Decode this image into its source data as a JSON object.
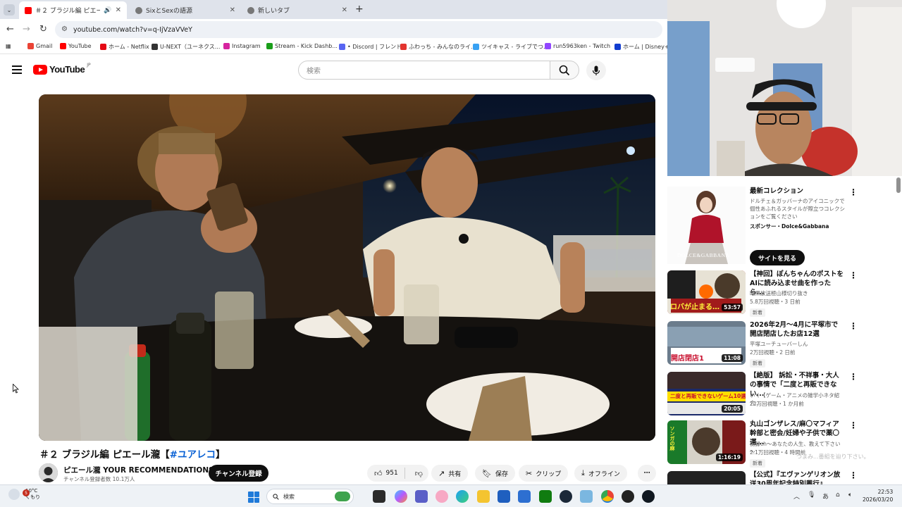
{
  "browser": {
    "tabs": [
      {
        "title": "＃２ ブラジル編 ピエール瀧【＃",
        "active": true
      },
      {
        "title": "SixとSexの語源",
        "active": false
      },
      {
        "title": "新しいタブ",
        "active": false
      }
    ],
    "url": "youtube.com/watch?v=q-IjVzaVVeY",
    "bookmarks": [
      {
        "label": "Gmail",
        "color": "#ea4335"
      },
      {
        "label": "YouTube",
        "color": "#ff0000"
      },
      {
        "label": "ホーム - Netflix",
        "color": "#e50914"
      },
      {
        "label": "U-NEXT（ユーネクス...",
        "color": "#333333"
      },
      {
        "label": "Instagram",
        "color": "#d6249f"
      },
      {
        "label": "Stream - Kick Dashb...",
        "color": "#1a9e1a"
      },
      {
        "label": "• Discord | フレンド",
        "color": "#5865f2"
      },
      {
        "label": "ふわっち - みんなのライ...",
        "color": "#e3342f"
      },
      {
        "label": "ツイキャス - ライブでつ...",
        "color": "#38a1f3"
      },
      {
        "label": "run5963ken - Twitch",
        "color": "#9146ff"
      },
      {
        "label": "ホーム | Disney+(デ",
        "color": "#113ccf"
      }
    ]
  },
  "header": {
    "logo_text": "YouTube",
    "logo_region": "JP",
    "search_placeholder": "検索"
  },
  "video": {
    "title_main": "＃２ ブラジル編 ピエール瀧【",
    "title_tag": "#ユアレコ",
    "title_end": "】",
    "channel_name": "ピエール瀧 YOUR RECOMMENDATIONS",
    "subscribers": "チャンネル登録者数 10.1万人",
    "subscribe_label": "チャンネル登録",
    "like_count": "951",
    "share_label": "共有",
    "save_label": "保存",
    "clip_label": "クリップ",
    "offline_label": "オフライン"
  },
  "sidebar": {
    "ad": {
      "title": "最新コレクション",
      "desc": "ドルチェ＆ガッバーナのアイコニックで個性あふれるスタイルが際立つコレクションをご覧ください",
      "sponsor": "スポンサー・Dolce&Gabbana",
      "brand": "DOLCE&GABBANA",
      "cta": "サイトを見る"
    },
    "videos": [
      {
        "title": "【神回】ぽんちゃんのポストをAIに読み込ませ曲を作ったら...",
        "channel": "暗黒放送極山様切り抜き",
        "stats": "5.8万回視聴・3 日前",
        "badge": "新着",
        "duration": "53:57",
        "thumb_text": "ロバが止まる…",
        "thumb_color": "#a11b1b"
      },
      {
        "title": "2026年2月〜4月に平塚市で開店閉店したお店12選",
        "channel": "平塚ユーチューバーしん",
        "stats": "2万回視聴・2 日前",
        "badge": "新着",
        "duration": "11:08",
        "thumb_text": "開店閉店1",
        "thumb_color": "#c8102e"
      },
      {
        "title": "【絶版】 訴訟・不祥事・大人の事情で「二度と再販できない...",
        "channel": "いく【ゲーム・アニメの雑学小ネタ紹介...",
        "stats": "22万回視聴・1 か月前",
        "badge": "",
        "duration": "20:05",
        "thumb_text": "二度と再販できないゲーム10選",
        "thumb_color": "#1b2a6b"
      },
      {
        "title": "丸山ゴンザレス/麻〇マフィア幹部と密会/妊婦や子供で薬〇運...",
        "channel": "街録ch～あなたの人生、教えて下さい～",
        "stats": "2.1万回視聴・4 時間前",
        "badge": "新着",
        "duration": "1:16:19",
        "thumb_text": "ソンガの麻",
        "thumb_color": "#7a1a1a"
      },
      {
        "title": "【公式】『エヴァンゲリオン放送30周年記念特別興行』",
        "channel": "",
        "stats": "",
        "badge": "",
        "duration": "",
        "thumb_text": "",
        "thumb_color": "#222222"
      }
    ],
    "overlay_text": "つまみ...番組を辿り下さい。"
  },
  "taskbar": {
    "temperature": "10°C",
    "condition": "くもり",
    "notification_count": "5",
    "search_label": "検索",
    "time": "22:53",
    "date": "2026/03/20",
    "ime": "あ"
  }
}
